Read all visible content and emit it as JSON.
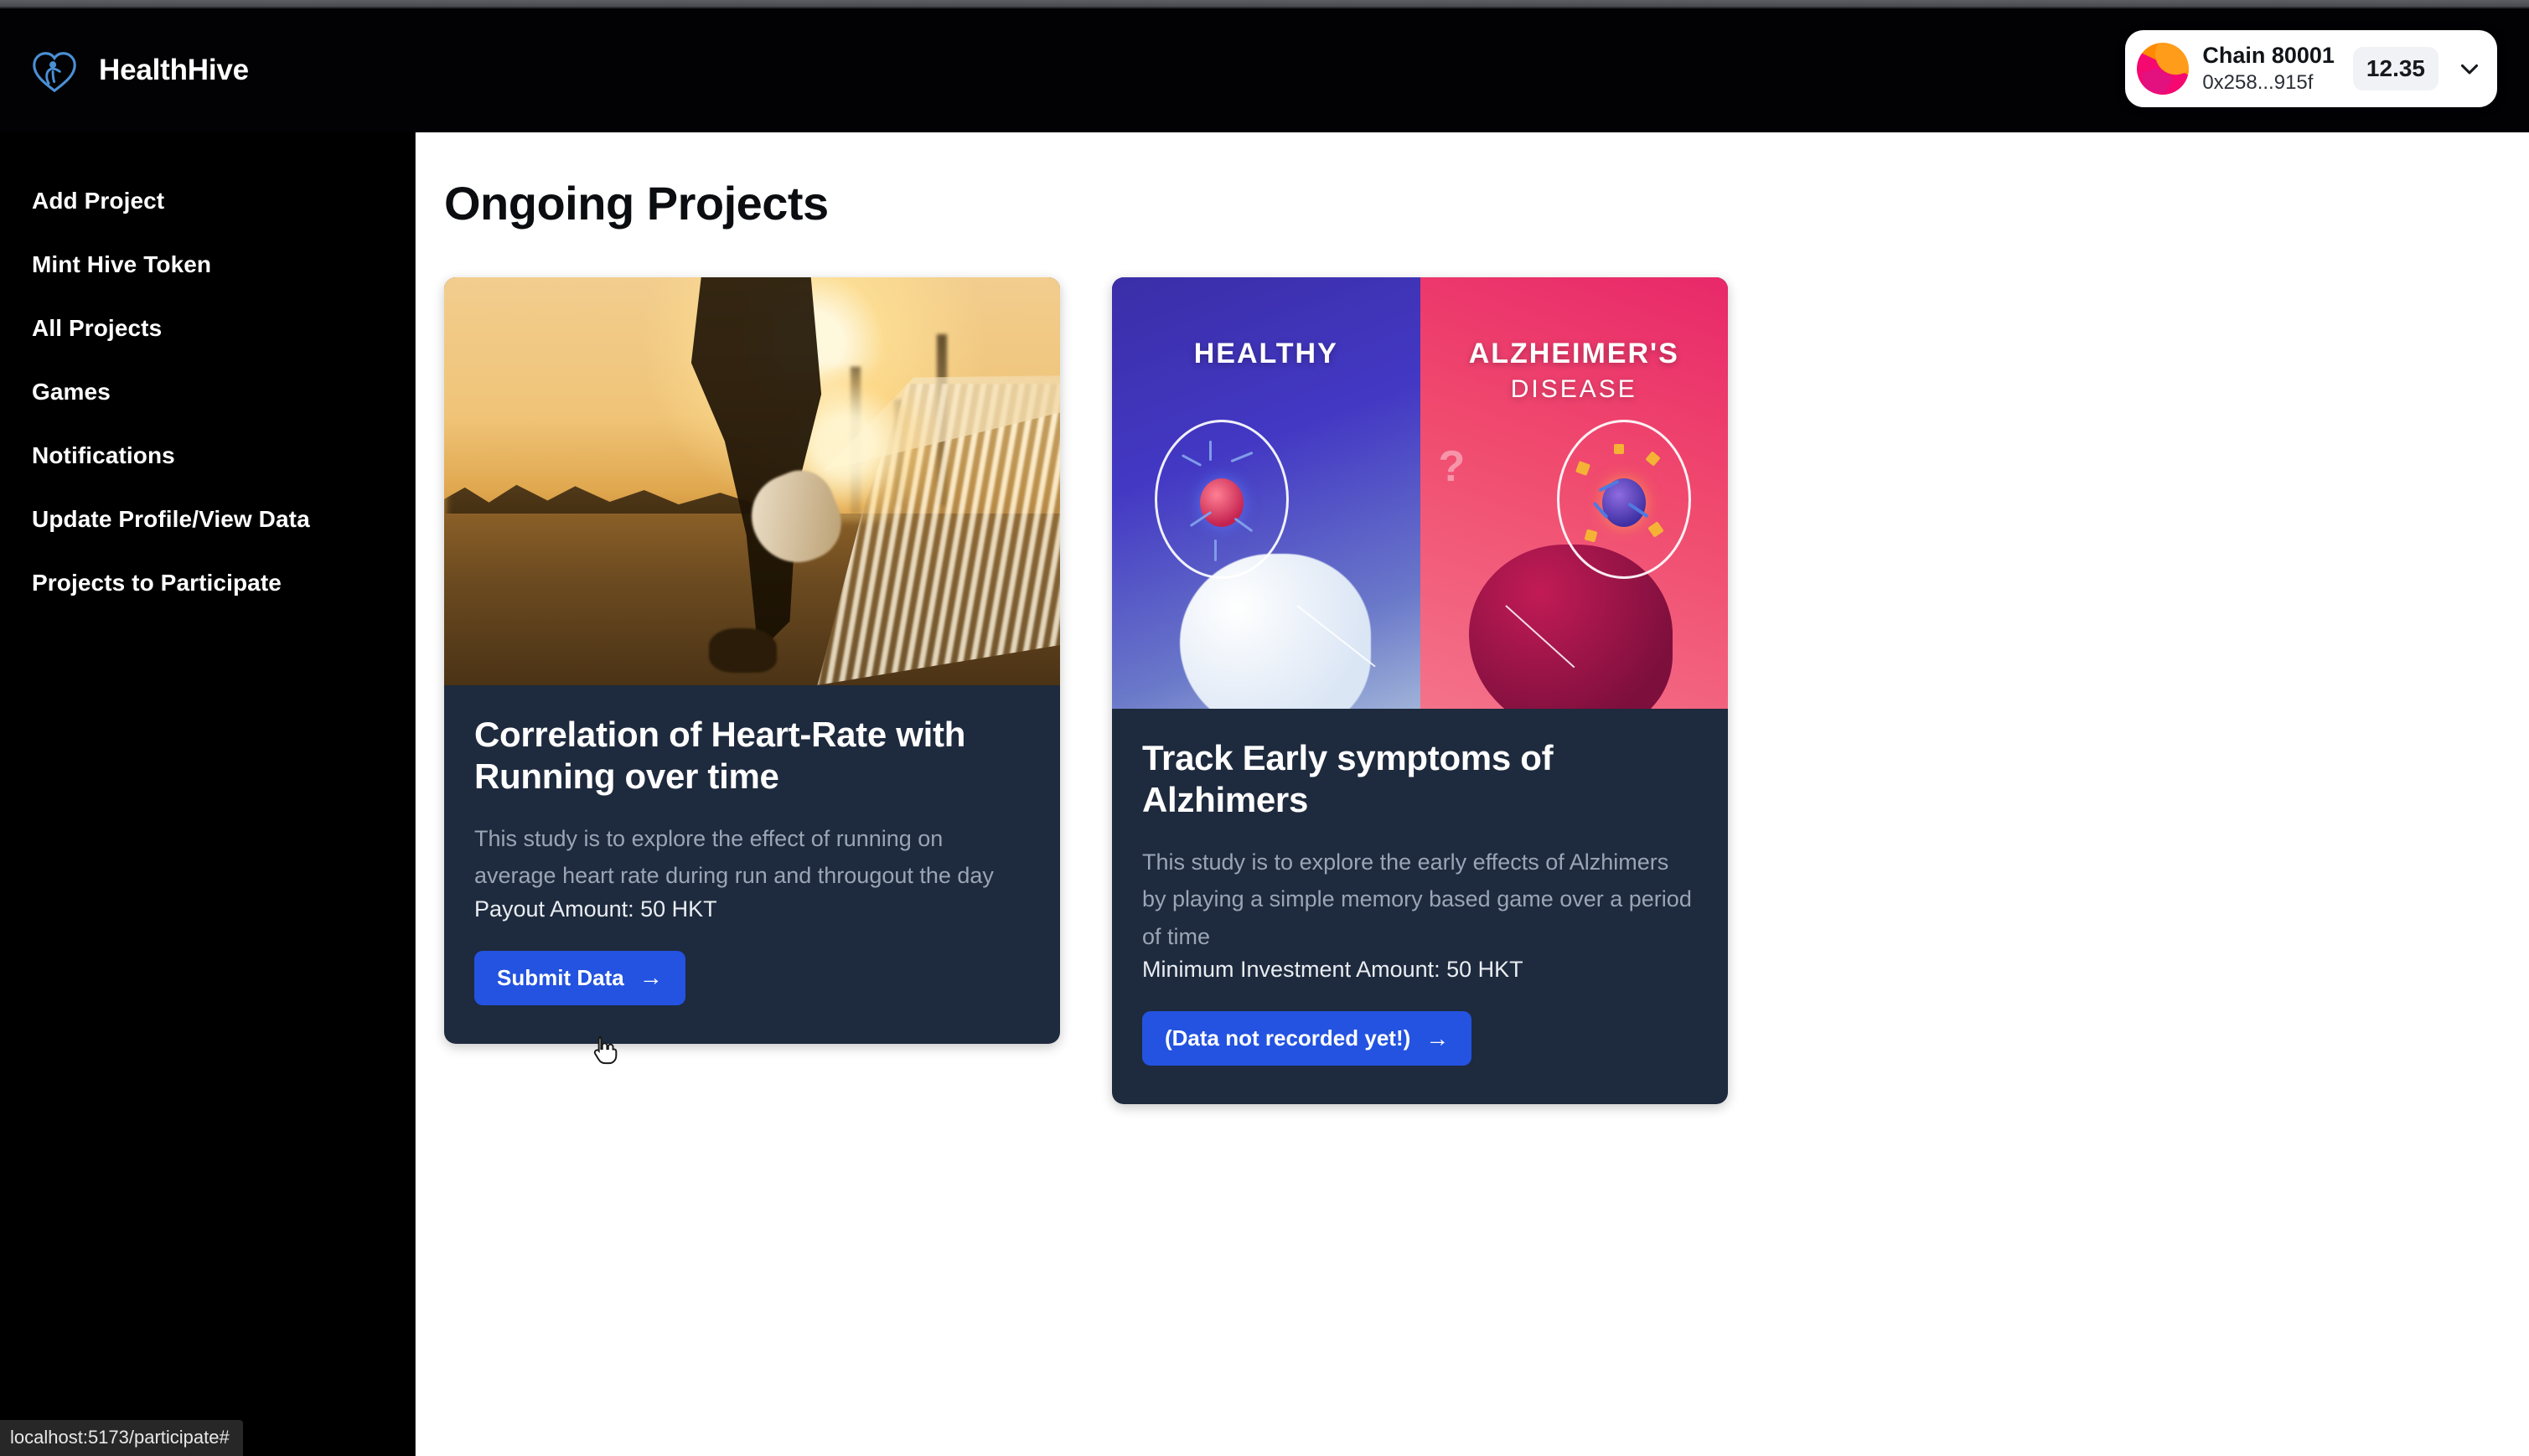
{
  "brand": {
    "name": "HealthHive",
    "logo_icon": "heart-person-logo-icon"
  },
  "wallet": {
    "chain": "Chain 80001",
    "address": "0x258...915f",
    "balance": "12.35",
    "avatar_icon": "wallet-avatar-icon",
    "chevron_icon": "chevron-down-icon"
  },
  "sidebar": {
    "items": [
      {
        "label": "Add Project"
      },
      {
        "label": "Mint Hive Token"
      },
      {
        "label": "All Projects"
      },
      {
        "label": "Games"
      },
      {
        "label": "Notifications"
      },
      {
        "label": "Update Profile/View Data"
      },
      {
        "label": "Projects to Participate"
      }
    ]
  },
  "main": {
    "title": "Ongoing Projects",
    "cards": [
      {
        "media": "runner-sunset-photo",
        "title": "Correlation of Heart-Rate with Running over time",
        "description": "This study is to explore the effect of running on average heart rate during run and througout the day",
        "amount": "Payout Amount: 50 HKT",
        "button_label": "Submit Data",
        "button_arrow": "→"
      },
      {
        "media": "healthy-vs-alzheimers-illustration",
        "media_labels": {
          "left": "HEALTHY",
          "right_line1": "ALZHEIMER'S",
          "right_line2": "DISEASE"
        },
        "title": "Track Early symptoms of Alzhimers",
        "description": "This study is to explore the early effects of Alzhimers by playing a simple memory based game over a period of time",
        "amount": "Minimum Investment Amount: 50 HKT",
        "button_label": "(Data not recorded yet!)",
        "button_arrow": "→"
      }
    ]
  },
  "statusbar": {
    "url": "localhost:5173/participate#"
  },
  "colors": {
    "accent": "#2353e0",
    "card_bg": "#1e2a3d",
    "sidebar_bg": "#000000",
    "brand_blue": "#4a8fd4"
  }
}
